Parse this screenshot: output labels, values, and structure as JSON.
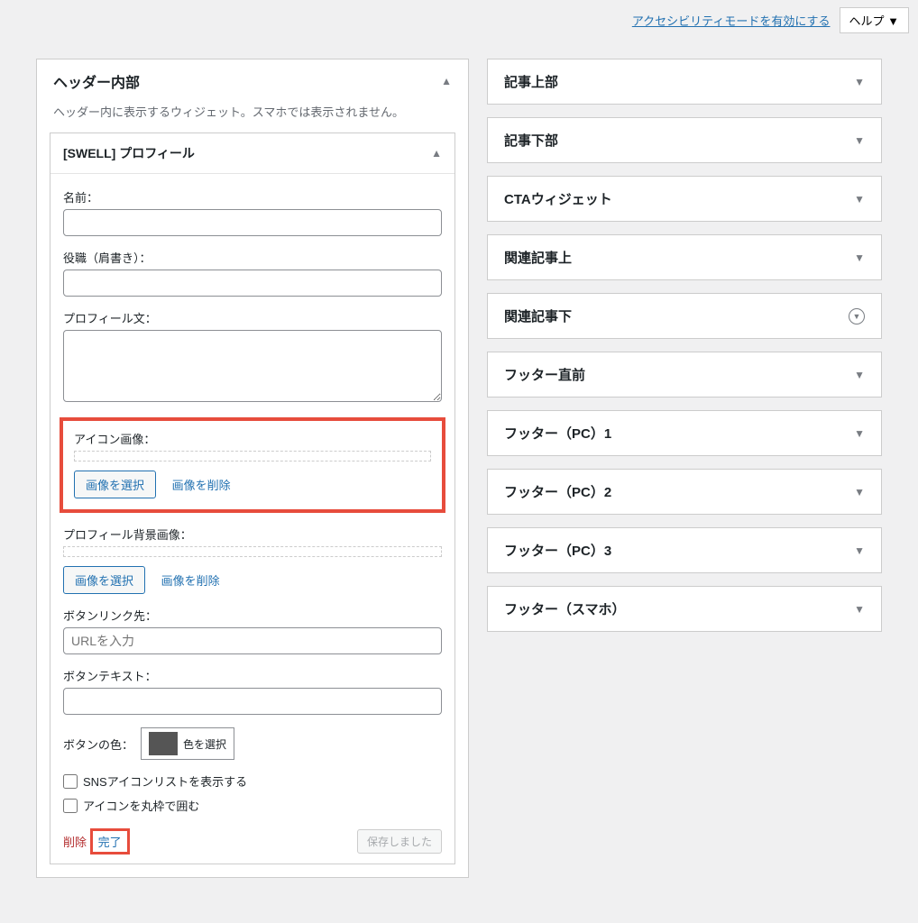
{
  "topbar": {
    "accessibility_link": "アクセシビリティモードを有効にする",
    "help_label": "ヘルプ ▼"
  },
  "left_panel": {
    "title": "ヘッダー内部",
    "description": "ヘッダー内に表示するウィジェット。スマホでは表示されません。"
  },
  "widget": {
    "title": "[SWELL] プロフィール",
    "name_label": "名前：",
    "position_label": "役職（肩書き）：",
    "profile_text_label": "プロフィール文：",
    "icon_image_label": "アイコン画像：",
    "select_image_btn": "画像を選択",
    "delete_image_link": "画像を削除",
    "bg_image_label": "プロフィール背景画像：",
    "button_link_label": "ボタンリンク先：",
    "button_link_placeholder": "URLを入力",
    "button_text_label": "ボタンテキスト：",
    "button_color_label": "ボタンの色：",
    "select_color_btn": "色を選択",
    "sns_checkbox_label": "SNSアイコンリストを表示する",
    "round_checkbox_label": "アイコンを丸枠で囲む",
    "delete_link": "削除",
    "done_link": "完了",
    "saved_btn": "保存しました"
  },
  "right_areas": [
    {
      "title": "記事上部",
      "caret": "down"
    },
    {
      "title": "記事下部",
      "caret": "down"
    },
    {
      "title": "CTAウィジェット",
      "caret": "down"
    },
    {
      "title": "関連記事上",
      "caret": "down"
    },
    {
      "title": "関連記事下",
      "caret": "circle"
    },
    {
      "title": "フッター直前",
      "caret": "down"
    },
    {
      "title": "フッター（PC）1",
      "caret": "down"
    },
    {
      "title": "フッター（PC）2",
      "caret": "down"
    },
    {
      "title": "フッター（PC）3",
      "caret": "down"
    },
    {
      "title": "フッター（スマホ）",
      "caret": "down"
    }
  ]
}
